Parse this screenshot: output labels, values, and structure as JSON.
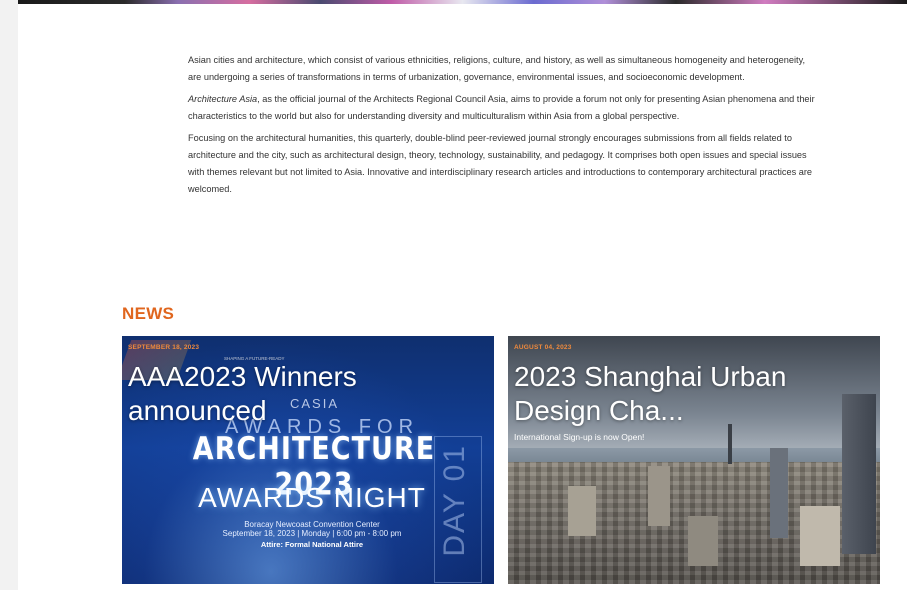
{
  "intro": {
    "p1": "Asian cities and architecture, which consist of various ethnicities, religions, culture, and history, as well as simultaneous homogeneity and heterogeneity, are undergoing a series of transformations in terms of urbanization, governance, environmental issues, and socioeconomic development.",
    "p2_journal": "Architecture Asia",
    "p2_rest": ", as the official journal of the Architects Regional Council Asia, aims to provide a forum not only for presenting Asian phenomena and their characteristics to the world but also for understanding diversity and multiculturalism within Asia from a global perspective.",
    "p3": "Focusing on the architectural humanities, this quarterly, double-blind peer-reviewed journal strongly encourages submissions from all fields related to architecture and the city, such as architectural design, theory, technology, sustainability, and pedagogy. It comprises both open issues and special issues with themes relevant but not limited to Asia. Innovative and interdisciplinary research articles and introductions to contemporary architectural practices are welcomed."
  },
  "news": {
    "heading": "NEWS",
    "cards": [
      {
        "date": "SEPTEMBER 18, 2023",
        "title": "AAA2023 Winners announced",
        "poster": {
          "small_text": "SHAPING A FUTURE-READY",
          "casia": "CASIA",
          "awards_for": "AWARDS FOR",
          "architecture": "ARCHITECTURE 2023",
          "night": "AWARDS NIGHT",
          "venue": "Boracay Newcoast Convention Center",
          "datetime": "September 18, 2023 | Monday | 6:00 pm - 8:00 pm",
          "attire": "Attire: Formal National Attire",
          "day": "DAY 01"
        }
      },
      {
        "date": "AUGUST 04, 2023",
        "title": "2023 Shanghai Urban Design Cha...",
        "subtitle": "International Sign-up is now Open!"
      }
    ]
  },
  "colors": {
    "accent": "#e0661e",
    "date": "#f08a3c",
    "text": "#333333"
  }
}
